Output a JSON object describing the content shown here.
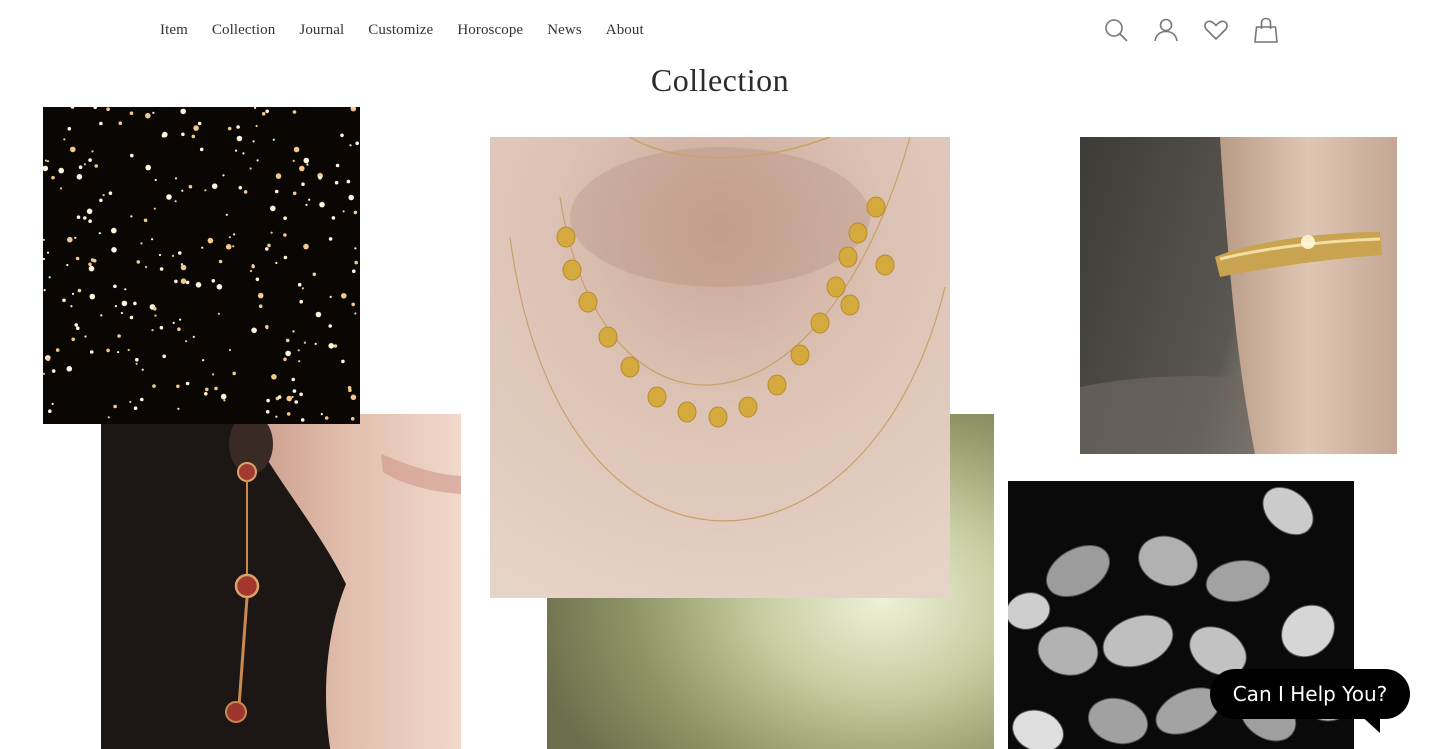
{
  "nav": {
    "items": [
      {
        "label": "Item"
      },
      {
        "label": "Collection"
      },
      {
        "label": "Journal"
      },
      {
        "label": "Customize"
      },
      {
        "label": "Horoscope"
      },
      {
        "label": "News"
      },
      {
        "label": "About"
      }
    ]
  },
  "header_icons": [
    "search-icon",
    "account-icon",
    "wishlist-heart-icon",
    "shopping-bag-icon"
  ],
  "page": {
    "title": "Collection"
  },
  "gallery": {
    "images": [
      "sparkling-lights-image",
      "earring-model-image",
      "coin-necklace-image",
      "green-blur-image",
      "gold-bangle-image",
      "rose-petals-image"
    ]
  },
  "chat": {
    "label": "Can I Help You?"
  },
  "colors": {
    "text": "#333333",
    "chat_bg": "#000000",
    "chat_text": "#ffffff"
  }
}
